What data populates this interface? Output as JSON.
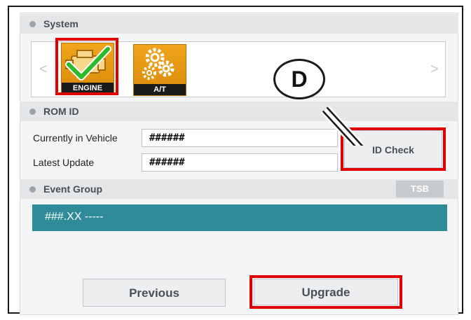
{
  "system": {
    "header": "System",
    "icons": [
      {
        "label": "ENGINE"
      },
      {
        "label": "A/T"
      }
    ],
    "prev_arrow": "<",
    "next_arrow": ">"
  },
  "rom_id": {
    "header": "ROM ID",
    "current_label": "Currently in Vehicle",
    "current_value": "######",
    "latest_label": "Latest Update",
    "latest_value": "######",
    "id_check_label": "ID Check"
  },
  "event_group": {
    "header": "Event Group",
    "tsb_label": "TSB",
    "items": [
      "###.XX -----"
    ]
  },
  "buttons": {
    "previous": "Previous",
    "upgrade": "Upgrade"
  },
  "callout": {
    "letter": "D"
  },
  "colors": {
    "highlight": "#e00000",
    "event_bg": "#2e8b97",
    "icon_orange": "#e89a14"
  }
}
